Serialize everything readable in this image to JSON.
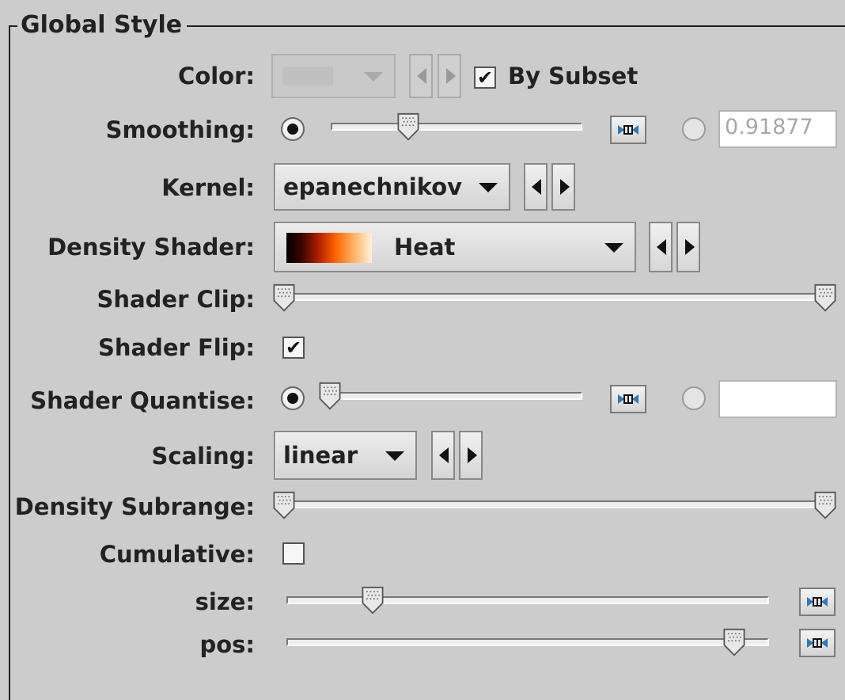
{
  "panel": {
    "title": "Global Style"
  },
  "color": {
    "label": "Color:",
    "by_subset_label": "By Subset",
    "by_subset_checked": true
  },
  "smoothing": {
    "label": "Smoothing:",
    "value_text": "0.91877",
    "slider_position": 0.31
  },
  "kernel": {
    "label": "Kernel:",
    "value": "epanechnikov"
  },
  "density_shader": {
    "label": "Density Shader:",
    "value": "Heat"
  },
  "shader_clip": {
    "label": "Shader Clip:",
    "range": [
      0.0,
      1.0
    ]
  },
  "shader_flip": {
    "label": "Shader Flip:",
    "checked": true
  },
  "shader_quantise": {
    "label": "Shader Quantise:",
    "value_text": "",
    "slider_position": 0.0
  },
  "scaling": {
    "label": "Scaling:",
    "value": "linear"
  },
  "density_subrange": {
    "label": "Density Subrange:",
    "range": [
      0.0,
      1.0
    ]
  },
  "cumulative": {
    "label": "Cumulative:",
    "checked": false
  },
  "size": {
    "label": "size:",
    "slider_position": 0.18
  },
  "pos": {
    "label": "pos:",
    "slider_position": 0.93
  },
  "icons": {
    "check": "✔"
  }
}
